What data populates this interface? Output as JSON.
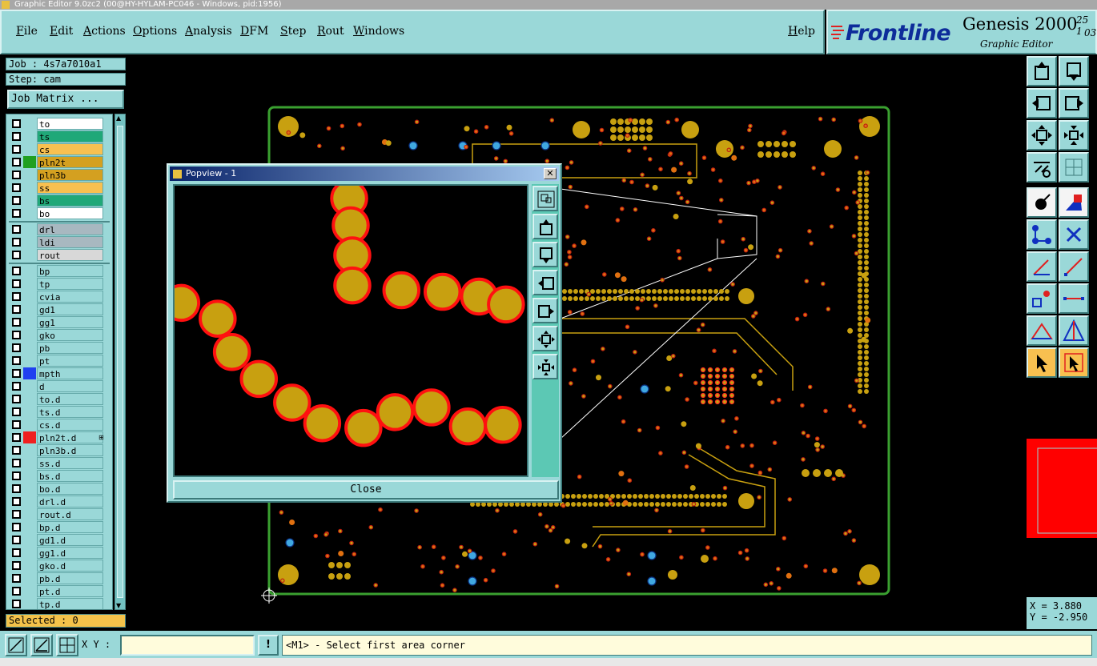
{
  "window": {
    "title": "Graphic Editor 9.0zc2 (00@HY-HYLAM-PC046 - Windows, pid:1956)"
  },
  "menu": {
    "items": [
      "File",
      "Edit",
      "Actions",
      "Options",
      "Analysis",
      "DFM",
      "Step",
      "Rout",
      "Windows"
    ],
    "help": "Help"
  },
  "brand": {
    "logo": "Frontline",
    "product": "Genesis 2000",
    "subtitle": "Graphic Editor",
    "date_line1": "25 1",
    "date_line2": "03"
  },
  "job": {
    "job_label": "Job : 4s7a7010a1",
    "step_label": "Step: cam",
    "matrix_button": "Job Matrix ..."
  },
  "layers": {
    "group1": [
      {
        "name": "to",
        "bg": "#ffffff",
        "color": ""
      },
      {
        "name": "ts",
        "bg": "#20a878",
        "color": ""
      },
      {
        "name": "cs",
        "bg": "#f8c050",
        "color": ""
      },
      {
        "name": "pln2t",
        "bg": "#d4a020",
        "color": "#20a020"
      },
      {
        "name": "pln3b",
        "bg": "#d4a020",
        "color": ""
      },
      {
        "name": "ss",
        "bg": "#f8c050",
        "color": ""
      },
      {
        "name": "bs",
        "bg": "#20a878",
        "color": ""
      },
      {
        "name": "bo",
        "bg": "#ffffff",
        "color": ""
      }
    ],
    "group2": [
      {
        "name": "drl",
        "bg": "#a8b8c0",
        "color": ""
      },
      {
        "name": "ldi",
        "bg": "#a8b8c0",
        "color": ""
      },
      {
        "name": "rout",
        "bg": "#d8d8d8",
        "color": ""
      }
    ],
    "group3": [
      {
        "name": "bp",
        "color": ""
      },
      {
        "name": "tp",
        "color": ""
      },
      {
        "name": "cvia",
        "color": ""
      },
      {
        "name": "gd1",
        "color": ""
      },
      {
        "name": "gg1",
        "color": ""
      },
      {
        "name": "gko",
        "color": ""
      },
      {
        "name": "pb",
        "color": ""
      },
      {
        "name": "pt",
        "color": ""
      },
      {
        "name": "mpth",
        "color": "#2040f0"
      },
      {
        "name": "d",
        "color": ""
      },
      {
        "name": "to.d",
        "color": ""
      },
      {
        "name": "ts.d",
        "color": ""
      },
      {
        "name": "cs.d",
        "color": ""
      },
      {
        "name": "pln2t.d",
        "color": "#f02020",
        "mark": "⊞"
      },
      {
        "name": "pln3b.d",
        "color": ""
      },
      {
        "name": "ss.d",
        "color": ""
      },
      {
        "name": "bs.d",
        "color": ""
      },
      {
        "name": "bo.d",
        "color": ""
      },
      {
        "name": "drl.d",
        "color": ""
      },
      {
        "name": "rout.d",
        "color": ""
      },
      {
        "name": "bp.d",
        "color": ""
      },
      {
        "name": "gd1.d",
        "color": ""
      },
      {
        "name": "gg1.d",
        "color": ""
      },
      {
        "name": "gko.d",
        "color": ""
      },
      {
        "name": "pb.d",
        "color": ""
      },
      {
        "name": "pt.d",
        "color": ""
      },
      {
        "name": "tp.d",
        "color": ""
      }
    ]
  },
  "status": {
    "selected": "Selected : 0"
  },
  "popview": {
    "title": "Popview - 1",
    "close_button": "Close",
    "close_x": "✕"
  },
  "coords": {
    "x": "X = 3.880",
    "y": "Y = -2.950"
  },
  "bottom": {
    "xy_label": "X Y :",
    "xy_value": "",
    "bang": "!",
    "prompt": "<M1> - Select first area corner"
  },
  "colors": {
    "panel": "#9ad8d8",
    "pad": "#c8a010",
    "pad_outline": "#ff1010",
    "board_outline": "#3aa030",
    "highlight": "#ff0000"
  }
}
